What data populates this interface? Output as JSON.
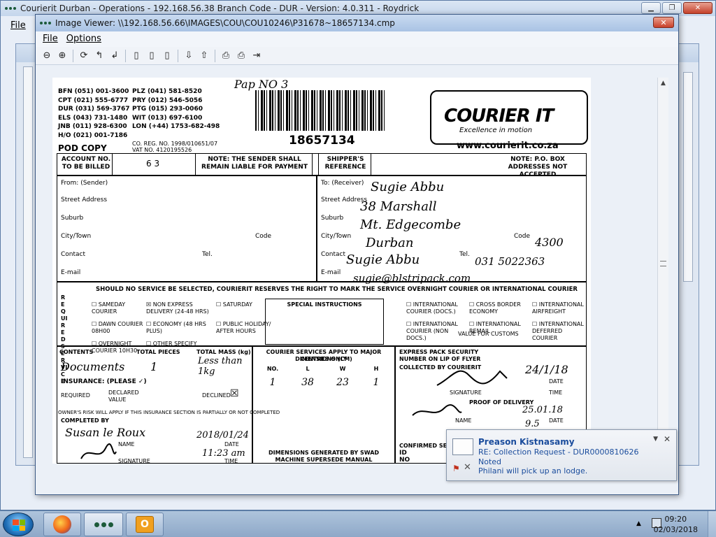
{
  "main_window": {
    "title": "Courierit Durban - Operations - 192.168.56.38 Branch Code - DUR - Version: 4.0.311 - Roydrick",
    "menu_file": "File"
  },
  "viewer": {
    "title": "Image Viewer: \\\\192.168.56.66\\IMAGES\\COU\\COU10246\\P31678~18657134.cmp",
    "menu": [
      "File",
      "Options"
    ],
    "close_label": "✕",
    "toolbar": [
      "zoom-out-icon",
      "zoom-in-icon",
      "rotate-icon",
      "rotate-left-icon",
      "rotate-right-icon",
      "page-first-icon",
      "page-icon",
      "page-last-icon",
      "arrow-down-icon",
      "arrow-up-icon",
      "print-icon",
      "print-setup-icon",
      "exit-icon"
    ]
  },
  "waybill": {
    "branch_codes_left": [
      "BFN (051) 001-3600",
      "CPT (021) 555-6777",
      "DUR (031) 569-3767",
      "ELS (043) 731-1480",
      "JNB (011) 928-6300",
      "H/O (021) 001-7186"
    ],
    "branch_codes_right": [
      "PLZ (041) 581-8520",
      "PRY (012) 546-5056",
      "PTG (015) 293-0060",
      "WIT (013) 697-6100",
      "LON (+44) 1753-682-498"
    ],
    "pod_copy": "POD COPY",
    "reg_no": "CO. REG. NO. 1998/010651/07",
    "vat_no": "VAT NO. 4120195526",
    "handwritten_top": "Pap NO 3",
    "waybill_number": "18657134",
    "brand": "COURIER IT",
    "slogan": "Excellence in motion",
    "website": "www.courierit.co.za",
    "account_label": "ACCOUNT NO. TO BE BILLED",
    "account_value": "6 3",
    "note_sender": "NOTE: THE SENDER SHALL REMAIN LIABLE FOR PAYMENT",
    "shippers_ref": "SHIPPER'S REFERENCE",
    "note_po": "NOTE: P.O. BOX ADDRESSES NOT ACCEPTED",
    "from_label": "From: (Sender)",
    "street_label": "Street Address",
    "suburb_label": "Suburb",
    "city_label": "City/Town",
    "code_label": "Code",
    "contact_label": "Contact",
    "tel_label": "Tel.",
    "email_label": "E-mail",
    "to_label": "To: (Receiver)",
    "receiver_name": "Sugie Abbu",
    "receiver_street": "38 Marshall",
    "receiver_suburb": "Mt. Edgecombe",
    "receiver_city": "Durban",
    "receiver_code": "4300",
    "receiver_contact": "Sugie Abbu",
    "receiver_tel": "031 5022363",
    "receiver_email": "sugie@blstripack.com",
    "service_notice": "SHOULD NO SERVICE BE SELECTED, COURIERIT RESERVES THE RIGHT TO MARK THE SERVICE OVERNIGHT COURIER OR INTERNATIONAL COURIER",
    "required_vertical": "REQUIRED SERVICE",
    "services": [
      "SAMEDAY COURIER",
      "NON EXPRESS DELIVERY (24-48 HRS)",
      "SATURDAY",
      "DAWN COURIER 08H00",
      "ECONOMY (48 HRS PLUS)",
      "PUBLIC HOLIDAY/ AFTER HOURS",
      "OVERNIGHT COURIER 10H30",
      "OTHER SPECIFY"
    ],
    "special_instructions": "SPECIAL INSTRUCTIONS",
    "intl_services": [
      "INTERNATIONAL COURIER (DOCS.)",
      "CROSS BORDER ECONOMY",
      "INTERNATIONAL AIRFREIGHT",
      "INTERNATIONAL COURIER (NON DOCS.)",
      "INTERNATIONAL REMAIL",
      "INTERNATIONAL DEFERRED COURIER"
    ],
    "value_customs": "VALUE FOR CUSTOMS",
    "contents_label": "CONTENTS",
    "contents_value": "Documents",
    "total_pieces_label": "TOTAL PIECES",
    "total_pieces_value": "1",
    "total_mass_label": "TOTAL MASS (kg)",
    "total_mass_value": "Less than 1kg",
    "insurance_label": "INSURANCE: (PLEASE ✓)",
    "required_label": "REQUIRED",
    "declared_label": "DECLARED VALUE",
    "declined_label": "DECLINED",
    "owners_risk": "OWNER'S RISK WILL APPLY IF THIS INSURANCE SECTION IS PARTIALLY OR NOT COMPLETED",
    "completed_by": "COMPLETED BY",
    "completed_name": "Susan le Roux",
    "name_label": "NAME",
    "signature_label": "SIGNATURE",
    "completed_date": "2018/01/24",
    "completed_time": "11:23 am",
    "date_label": "DATE",
    "time_label": "TIME",
    "dims_header": "COURIER SERVICES APPLY TO MAJOR CENTRES ONLY",
    "dims_title": "DIMENSIONS (CM)",
    "dims_cols": [
      "NO.",
      "L",
      "W",
      "H"
    ],
    "dims_row": [
      "1",
      "38",
      "23",
      "1"
    ],
    "dims_note": "DIMENSIONS GENERATED BY SWAD MACHINE SUPERSEDE MANUAL DIMENSIONS",
    "express_label": "EXPRESS PACK SECURITY NUMBER ON LIP OF FLYER",
    "collected_label": "COLLECTED BY COURIERIT",
    "collected_date": "24/1/18",
    "proof_label": "PROOF OF DELIVERY",
    "pod_date": "25.01.18",
    "pod_time": "9.5",
    "confirmed_label": "CONFIRMED SECURITY",
    "id_label": "ID",
    "no_label": "NO"
  },
  "notification": {
    "sender": "Preason Kistnasamy",
    "subject": "RE: Collection Request - DUR0000810626",
    "line1": "Noted",
    "line2": "Philani will pick up an lodge."
  },
  "taskbar": {
    "time": "09:20",
    "date": "02/03/2018"
  },
  "colors": {
    "title_blue": "#c9daf0",
    "notify_text": "#1a4c9c",
    "close_red": "#c8402a"
  }
}
